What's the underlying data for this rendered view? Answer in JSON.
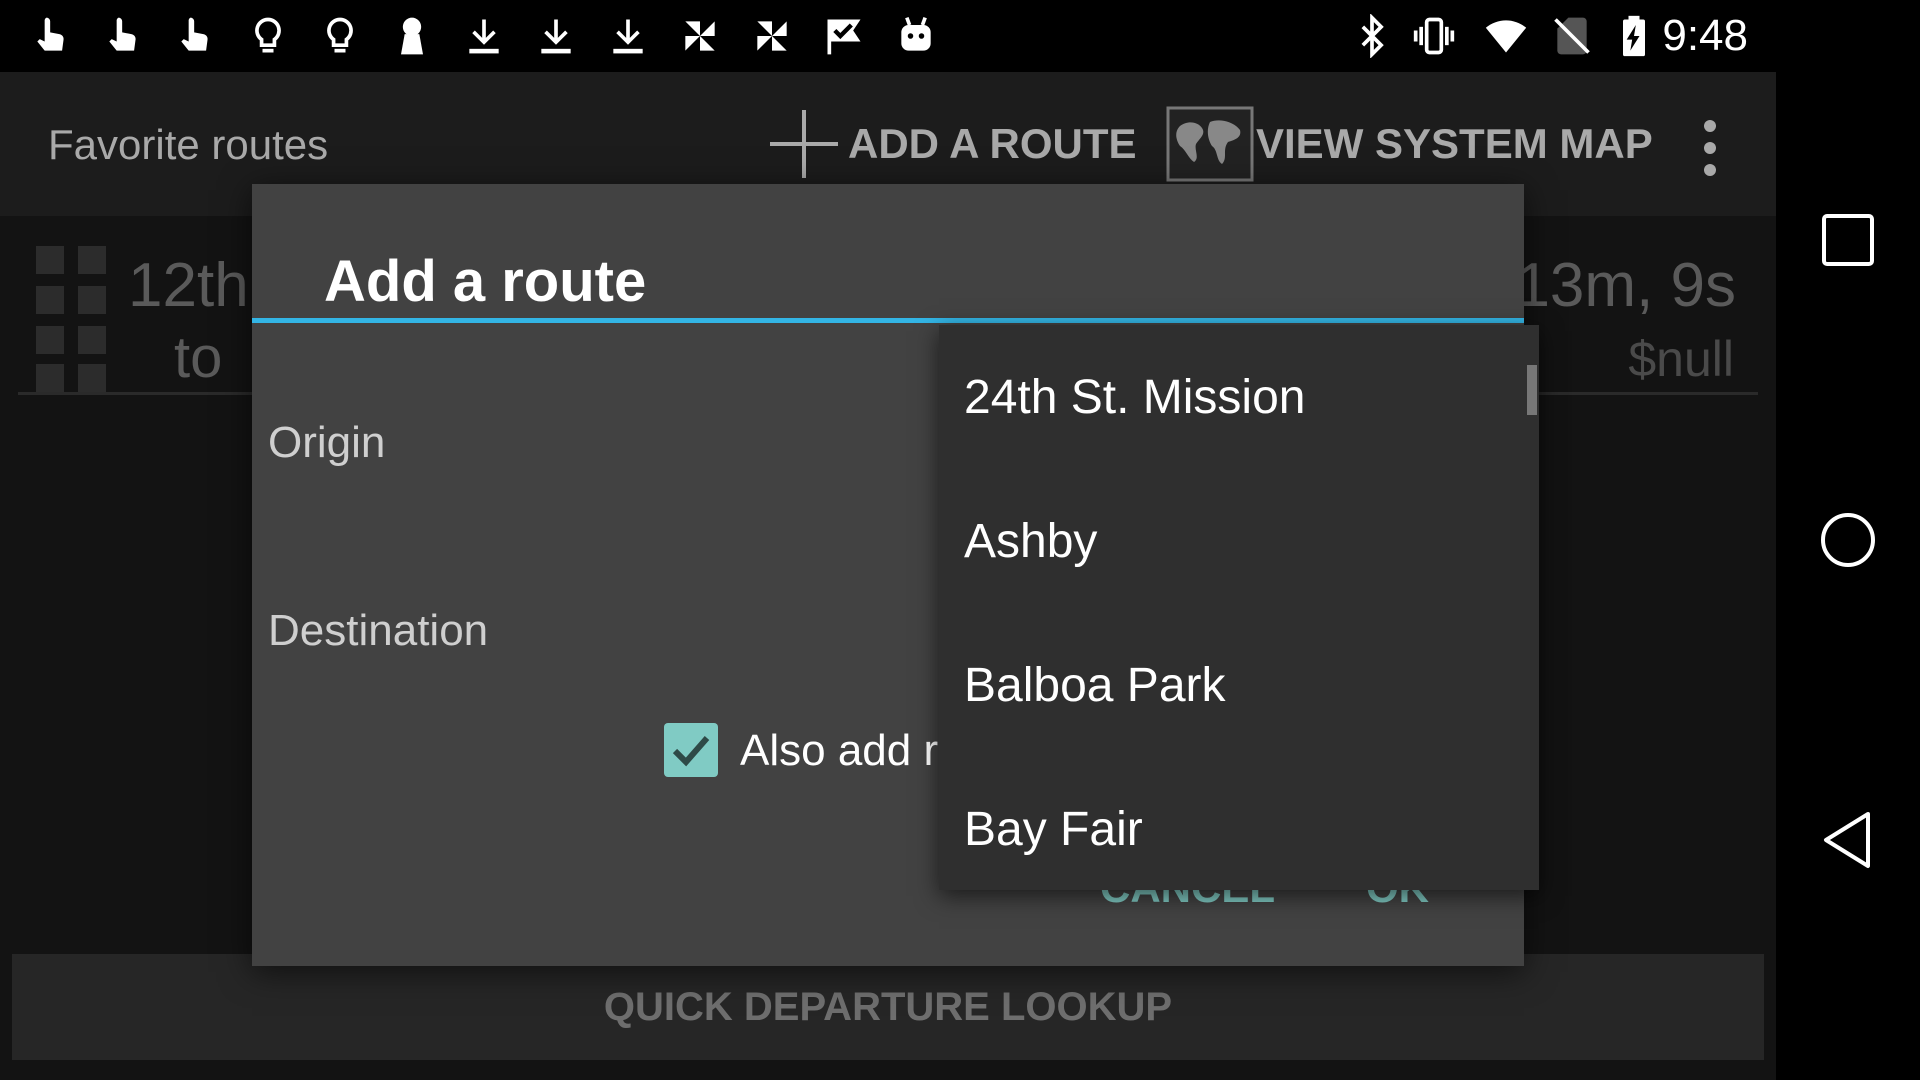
{
  "status_bar": {
    "left_icons": [
      "touch-icon",
      "touch-icon",
      "touch-icon",
      "lightbulb-icon",
      "lightbulb-icon",
      "keyhole-icon",
      "download-icon",
      "download-icon",
      "download-icon",
      "pinwheel-icon",
      "pinwheel-icon",
      "check-flag-icon",
      "android-icon"
    ],
    "right_icons": [
      "bluetooth-icon",
      "vibrate-icon",
      "wifi-icon",
      "no-sim-icon",
      "battery-charging-icon"
    ],
    "time": "9:48"
  },
  "action_bar": {
    "title": "Favorite routes",
    "add_route_label": "ADD A ROUTE",
    "view_map_label": "VIEW SYSTEM MAP"
  },
  "route_row": {
    "origin": "12th",
    "to": "to",
    "time": "13m, 9s",
    "fare": "$null"
  },
  "quick_lookup_label": "QUICK DEPARTURE LOOKUP",
  "dialog": {
    "title": "Add a route",
    "origin_label": "Origin",
    "destination_label": "Destination",
    "also_add_label": "Also add re",
    "also_add_checked": true,
    "cancel_label": "CANCEL",
    "ok_label": "OK"
  },
  "dropdown": {
    "items": [
      "24th St. Mission",
      "Ashby",
      "Balboa Park",
      "Bay Fair"
    ]
  },
  "colors": {
    "accent": "#33b5e5",
    "teal": "#80cbc4",
    "dialog_bg": "#424242",
    "dropdown_bg": "#2f2f2f"
  }
}
